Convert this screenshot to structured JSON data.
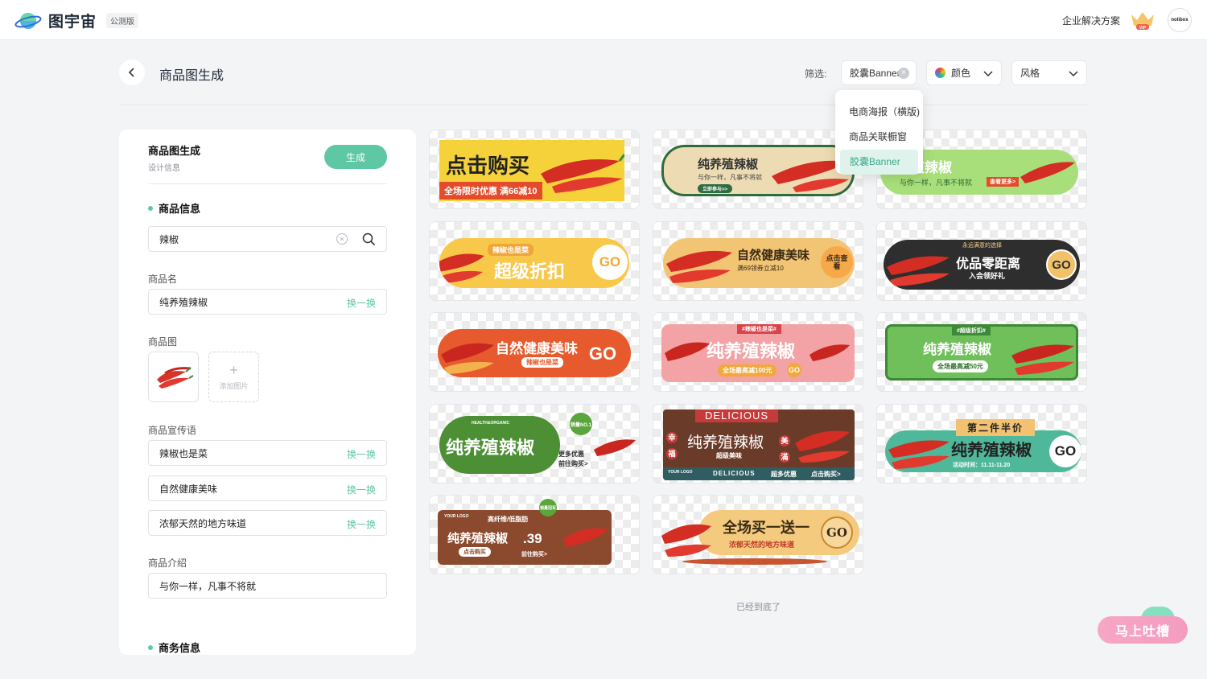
{
  "app": {
    "name": "图宇宙",
    "beta": "公测版",
    "enterprise": "企业解决方案",
    "avatar_text": "nolibox"
  },
  "header": {
    "title": "商品图生成",
    "filter_label": "筛选:",
    "filter_capsule": "胶囊Banner",
    "filter_color": "颜色",
    "filter_style": "风格"
  },
  "dropdown": {
    "items": [
      {
        "label": "电商海报（横版)"
      },
      {
        "label": "商品关联橱窗"
      },
      {
        "label": "胶囊Banner",
        "selected": true
      }
    ]
  },
  "panel": {
    "title": "商品图生成",
    "subtitle": "设计信息",
    "generate": "生成",
    "section_product": "商品信息",
    "search_value": "辣椒",
    "name_label": "商品名",
    "name_value": "纯养殖辣椒",
    "swap": "换一换",
    "image_label": "商品图",
    "add_image": "添加图片",
    "slogan_label": "商品宣传语",
    "slogans": [
      "辣椒也是菜",
      "自然健康美味",
      "浓郁天然的地方味道"
    ],
    "intro_label": "商品介绍",
    "intro_value": "与你一样，凡事不将就",
    "section_business": "商务信息"
  },
  "banners": {
    "b1": {
      "t1": "点击购买",
      "t2": "全场限时优惠 满66减10"
    },
    "b2": {
      "t1": "纯养殖辣椒",
      "t2": "与你一样，凡事不将就",
      "t3": "立即参与>>"
    },
    "b3": {
      "t1": "殖辣椒",
      "t2": "与你一样，凡事不将就",
      "t3": "查看更多>"
    },
    "b4": {
      "t1": "辣椒也是菜",
      "t2": "超级折扣",
      "go": "GO"
    },
    "b5": {
      "t1": "自然健康美味",
      "t2": "满69领券立减10",
      "t3": "点击查看"
    },
    "b6": {
      "t1": "永远满意的选择",
      "t2": "优品零距离",
      "t3": "入会领好礼",
      "go": "GO"
    },
    "b7": {
      "t1": "自然健康美味",
      "t2": "辣椒也是菜",
      "go": "GO"
    },
    "b8": {
      "t1": "#辣椒也是菜#",
      "t2": "纯养殖辣椒",
      "t3": "全场最高减100元",
      "go": "GO"
    },
    "b9": {
      "t1": "#超级折扣#",
      "t2": "纯养殖辣椒",
      "t3": "全场最高减50元"
    },
    "b10": {
      "t1": "HEALTH&ORGANIC",
      "t2": "纯养殖辣椒",
      "t3": "更多优惠",
      "t4": "前往购买>",
      "badge": "销量NO.1"
    },
    "b11": {
      "t1": "DELICIOUS",
      "t2": "纯养殖辣椒",
      "t3": "超级美味",
      "t4": "DELICIOUS",
      "t5": "超多优惠",
      "t6": "点击购买>",
      "l1": "幸",
      "l2": "福",
      "r1": "美",
      "r2": "滿",
      "logo": "YOUR LOGO"
    },
    "b12": {
      "t1": "第二件半价",
      "t2": "纯养殖辣椒",
      "t3": "活动时间：11.11-11.20",
      "go": "GO"
    },
    "b13": {
      "t1": "YOUR LOGO",
      "t2": "高纤维/低脂肪",
      "t3": "纯养殖辣椒",
      "t4": "点击购买",
      "t5": ".39",
      "t6": "前往购买>",
      "badge": "销量冠军"
    },
    "b14": {
      "t1": "全场买一送一",
      "t2": "浓郁天然的地方味道",
      "go": "GO"
    }
  },
  "bottom_note": "已经到底了",
  "feedback": "马上吐槽"
}
